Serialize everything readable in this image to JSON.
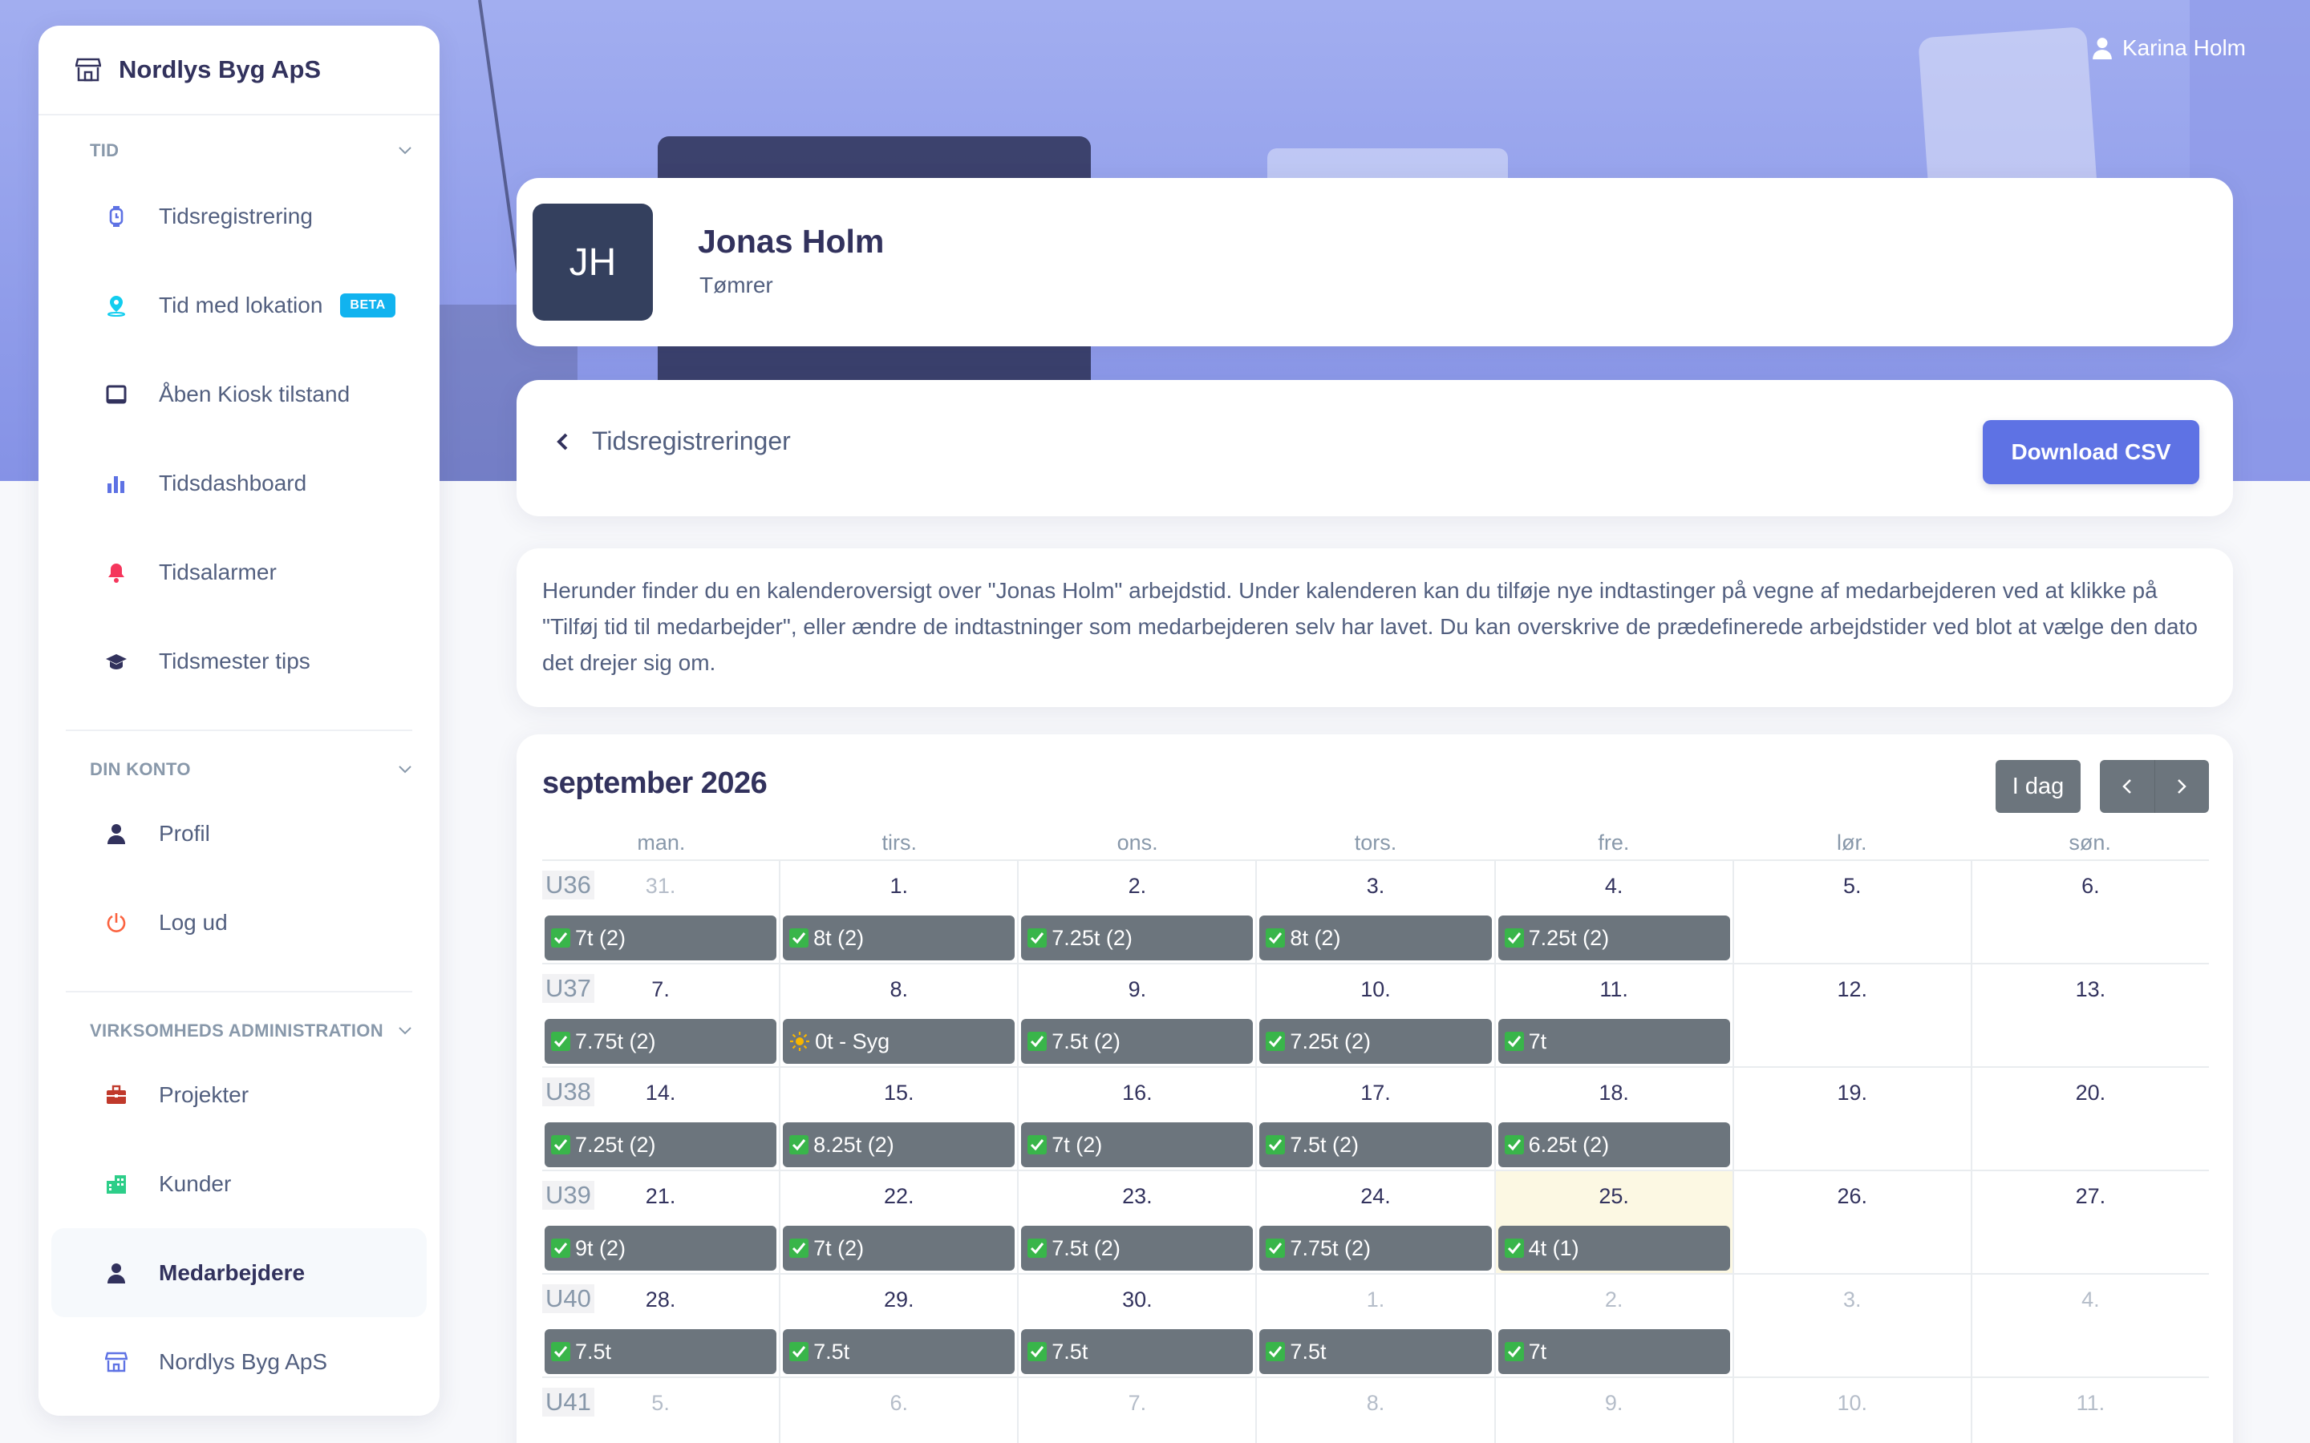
{
  "topbar": {
    "user_name": "Karina Holm"
  },
  "sidebar": {
    "company": "Nordlys Byg ApS",
    "sections": [
      {
        "title": "TID",
        "items": [
          {
            "label": "Tidsregistrering",
            "icon": "stopwatch-icon",
            "color": "#5e72e4"
          },
          {
            "label": "Tid med lokation",
            "icon": "map-pin-icon",
            "color": "#11cdef",
            "badge": "BETA"
          },
          {
            "label": "Åben Kiosk tilstand",
            "icon": "tablet-icon",
            "color": "#32325d"
          },
          {
            "label": "Tidsdashboard",
            "icon": "bar-chart-icon",
            "color": "#5e72e4"
          },
          {
            "label": "Tidsalarmer",
            "icon": "bell-icon",
            "color": "#f5365c"
          },
          {
            "label": "Tidsmester tips",
            "icon": "graduation-cap-icon",
            "color": "#32325d"
          }
        ]
      },
      {
        "title": "DIN KONTO",
        "items": [
          {
            "label": "Profil",
            "icon": "user-icon",
            "color": "#32325d"
          },
          {
            "label": "Log ud",
            "icon": "power-icon",
            "color": "#fb6340"
          }
        ]
      },
      {
        "title": "VIRKSOMHEDS ADMINISTRATION",
        "items": [
          {
            "label": "Projekter",
            "icon": "briefcase-icon",
            "color": "#c0392b"
          },
          {
            "label": "Kunder",
            "icon": "building-icon",
            "color": "#2dce89"
          },
          {
            "label": "Medarbejdere",
            "icon": "user-icon",
            "color": "#32325d",
            "active": true
          },
          {
            "label": "Nordlys Byg ApS",
            "icon": "store-icon",
            "color": "#5e72e4"
          }
        ]
      }
    ]
  },
  "profile": {
    "initials": "JH",
    "name": "Jonas Holm",
    "role": "Tømrer"
  },
  "header": {
    "back_label": "Tidsregistreringer",
    "csv_button": "Download CSV"
  },
  "info_text": "Herunder finder du en kalenderoversigt over \"Jonas Holm\" arbejdstid. Under kalenderen kan du tilføje nye indtastinger på vegne af medarbejderen ved at klikke på \"Tilføj tid til medarbejder\", eller ændre de indtastninger som medarbejderen selv har lavet. Du kan overskrive de prædefinerede arbejdstider ved blot at vælge den dato det drejer sig om.",
  "calendar": {
    "title": "september 2026",
    "today_button": "I dag",
    "weekdays": [
      "man.",
      "tirs.",
      "ons.",
      "tors.",
      "fre.",
      "lør.",
      "søn."
    ],
    "weeks": [
      {
        "label": "U36",
        "days": [
          {
            "num": "31.",
            "muted": true,
            "event": "7t (2)"
          },
          {
            "num": "1.",
            "event": "8t (2)"
          },
          {
            "num": "2.",
            "event": "7.25t (2)"
          },
          {
            "num": "3.",
            "event": "8t (2)"
          },
          {
            "num": "4.",
            "event": "7.25t (2)"
          },
          {
            "num": "5."
          },
          {
            "num": "6."
          }
        ]
      },
      {
        "label": "U37",
        "days": [
          {
            "num": "7.",
            "event": "7.75t (2)"
          },
          {
            "num": "8.",
            "event": "0t - Syg",
            "icon": "sun"
          },
          {
            "num": "9.",
            "event": "7.5t (2)"
          },
          {
            "num": "10.",
            "event": "7.25t (2)"
          },
          {
            "num": "11.",
            "event": "7t"
          },
          {
            "num": "12."
          },
          {
            "num": "13."
          }
        ]
      },
      {
        "label": "U38",
        "days": [
          {
            "num": "14.",
            "event": "7.25t (2)"
          },
          {
            "num": "15.",
            "event": "8.25t (2)"
          },
          {
            "num": "16.",
            "event": "7t (2)"
          },
          {
            "num": "17.",
            "event": "7.5t (2)"
          },
          {
            "num": "18.",
            "event": "6.25t (2)"
          },
          {
            "num": "19."
          },
          {
            "num": "20."
          }
        ]
      },
      {
        "label": "U39",
        "days": [
          {
            "num": "21.",
            "event": "9t (2)"
          },
          {
            "num": "22.",
            "event": "7t (2)"
          },
          {
            "num": "23.",
            "event": "7.5t (2)"
          },
          {
            "num": "24.",
            "event": "7.75t (2)"
          },
          {
            "num": "25.",
            "event": "4t (1)",
            "today": true
          },
          {
            "num": "26."
          },
          {
            "num": "27."
          }
        ]
      },
      {
        "label": "U40",
        "days": [
          {
            "num": "28.",
            "event": "7.5t"
          },
          {
            "num": "29.",
            "event": "7.5t"
          },
          {
            "num": "30.",
            "event": "7.5t"
          },
          {
            "num": "1.",
            "muted": true,
            "event": "7.5t"
          },
          {
            "num": "2.",
            "muted": true,
            "event": "7t"
          },
          {
            "num": "3.",
            "muted": true
          },
          {
            "num": "4.",
            "muted": true
          }
        ]
      },
      {
        "label": "U41",
        "days": [
          {
            "num": "5.",
            "muted": true
          },
          {
            "num": "6.",
            "muted": true
          },
          {
            "num": "7.",
            "muted": true
          },
          {
            "num": "8.",
            "muted": true
          },
          {
            "num": "9.",
            "muted": true
          },
          {
            "num": "10.",
            "muted": true
          },
          {
            "num": "11.",
            "muted": true
          }
        ]
      }
    ]
  }
}
